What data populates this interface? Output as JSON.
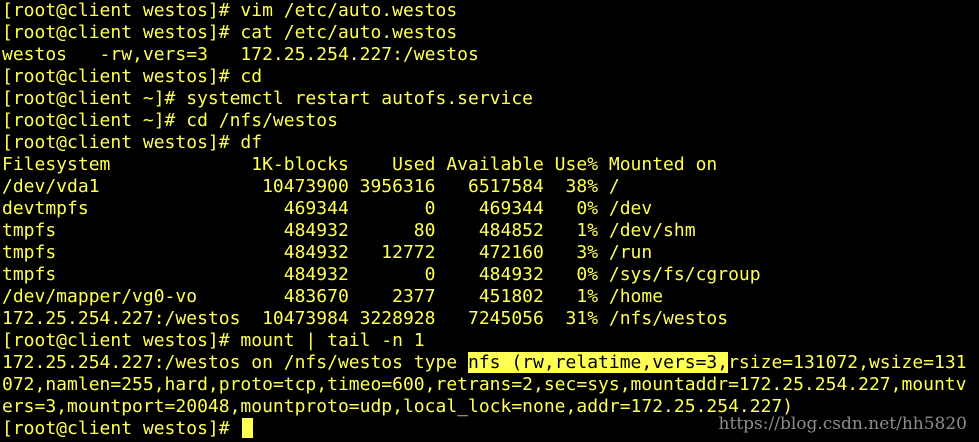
{
  "terminal": {
    "colors": {
      "background": "#000000",
      "text": "#ffff55",
      "highlight_bg": "#ffff55",
      "highlight_fg": "#000000"
    },
    "lines": [
      "[root@client westos]# vim /etc/auto.westos",
      "[root@client westos]# cat /etc/auto.westos",
      "westos   -rw,vers=3   172.25.254.227:/westos",
      "[root@client westos]# cd",
      "[root@client ~]# systemctl restart autofs.service",
      "[root@client ~]# cd /nfs/westos",
      "[root@client westos]# df",
      "Filesystem             1K-blocks    Used Available Use% Mounted on",
      "/dev/vda1               10473900 3956316   6517584  38% /",
      "devtmpfs                  469344       0    469344   0% /dev",
      "tmpfs                     484932      80    484852   1% /dev/shm",
      "tmpfs                     484932   12772    472160   3% /run",
      "tmpfs                     484932       0    484932   0% /sys/fs/cgroup",
      "/dev/mapper/vg0-vo        483670    2377    451802   1% /home",
      "172.25.254.227:/westos  10473984 3228928   7245056  31% /nfs/westos",
      "[root@client westos]# mount | tail -n 1"
    ],
    "mount_output": {
      "line1_before": "172.25.254.227:/westos on /nfs/westos type ",
      "line1_highlight": "nfs (rw,relatime,vers=3,",
      "line1_after": "rsize=131072,wsize=131",
      "line2": "072,namlen=255,hard,proto=tcp,timeo=600,retrans=2,sec=sys,mountaddr=172.25.254.227,mountv",
      "line3": "ers=3,mountport=20048,mountproto=udp,local_lock=none,addr=172.25.254.227)"
    },
    "final_prompt": "[root@client westos]# "
  },
  "watermark": "https://blog.csdn.net/hh5820"
}
